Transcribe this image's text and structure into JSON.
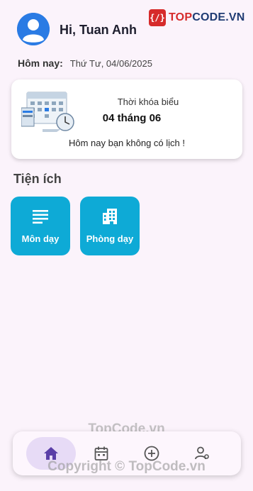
{
  "header": {
    "greeting": "Hi, Tuan Anh",
    "brand_mark": "{/}",
    "brand_top": "TOP",
    "brand_code": "CODE.VN"
  },
  "today": {
    "label": "Hôm nay:",
    "value": "Thứ Tư, 04/06/2025"
  },
  "schedule_card": {
    "title": "Thời khóa biểu",
    "date": "04 tháng 06",
    "message": "Hôm nay bạn không có lịch !"
  },
  "utilities": {
    "title": "Tiện ích",
    "items": [
      {
        "label": "Môn dạy",
        "icon": "list-icon"
      },
      {
        "label": "Phòng dạy",
        "icon": "building-icon"
      }
    ]
  },
  "bottom_nav": {
    "items": [
      {
        "icon": "home-icon",
        "active": true
      },
      {
        "icon": "calendar-icon",
        "active": false
      },
      {
        "icon": "add-circle-icon",
        "active": false
      },
      {
        "icon": "user-settings-icon",
        "active": false
      }
    ]
  },
  "watermarks": {
    "top": "TopCode.vn",
    "bottom": "Copyright © TopCode.vn"
  },
  "colors": {
    "background": "#fbf3fb",
    "accent": "#0eaad6",
    "nav_active": "#e7dbf6",
    "icon": "#5b3fa8",
    "brand_red": "#d62b2b"
  }
}
